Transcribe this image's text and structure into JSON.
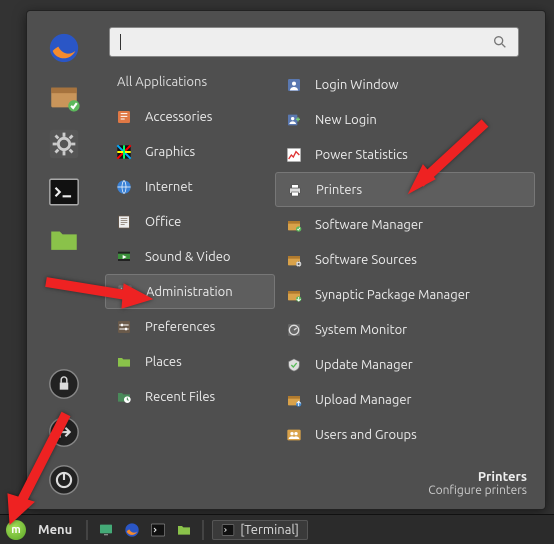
{
  "search": {
    "placeholder": ""
  },
  "categories_heading": "All Applications",
  "categories": [
    {
      "label": "Accessories",
      "icon": "accessories",
      "color": "#e07845"
    },
    {
      "label": "Graphics",
      "icon": "graphics",
      "color": "#000"
    },
    {
      "label": "Internet",
      "icon": "internet",
      "color": "#3b82d6"
    },
    {
      "label": "Office",
      "icon": "office",
      "color": "#6a5a4a"
    },
    {
      "label": "Sound & Video",
      "icon": "multimedia",
      "color": "#3a8f3a"
    },
    {
      "label": "Administration",
      "icon": "administration",
      "color": "#777"
    },
    {
      "label": "Preferences",
      "icon": "preferences",
      "color": "#6a5a4a"
    },
    {
      "label": "Places",
      "icon": "places",
      "color": "#8ac24a"
    },
    {
      "label": "Recent Files",
      "icon": "recent",
      "color": "#4a8a5a"
    }
  ],
  "apps": [
    {
      "label": "Login Window",
      "icon": "login-window",
      "color": "#5a78b0"
    },
    {
      "label": "New Login",
      "icon": "new-login",
      "color": "#5a78b0"
    },
    {
      "label": "Power Statistics",
      "icon": "power-stats",
      "color": "#fff"
    },
    {
      "label": "Printers",
      "icon": "printer",
      "color": "#444"
    },
    {
      "label": "Software Manager",
      "icon": "software-manager",
      "color": "#d9a24a"
    },
    {
      "label": "Software Sources",
      "icon": "software-sources",
      "color": "#d9a24a"
    },
    {
      "label": "Synaptic Package Manager",
      "icon": "synaptic",
      "color": "#d9a24a"
    },
    {
      "label": "System Monitor",
      "icon": "system-monitor",
      "color": "#888"
    },
    {
      "label": "Update Manager",
      "icon": "update-manager",
      "color": "#ccc"
    },
    {
      "label": "Upload Manager",
      "icon": "upload-manager",
      "color": "#d9a24a"
    },
    {
      "label": "Users and Groups",
      "icon": "users-groups",
      "color": "#d9a24a"
    }
  ],
  "selected_category_index": 5,
  "selected_app_index": 3,
  "footer": {
    "title": "Printers",
    "desc": "Configure printers"
  },
  "taskbar": {
    "menu": "Menu",
    "task_label": "[Terminal]"
  }
}
